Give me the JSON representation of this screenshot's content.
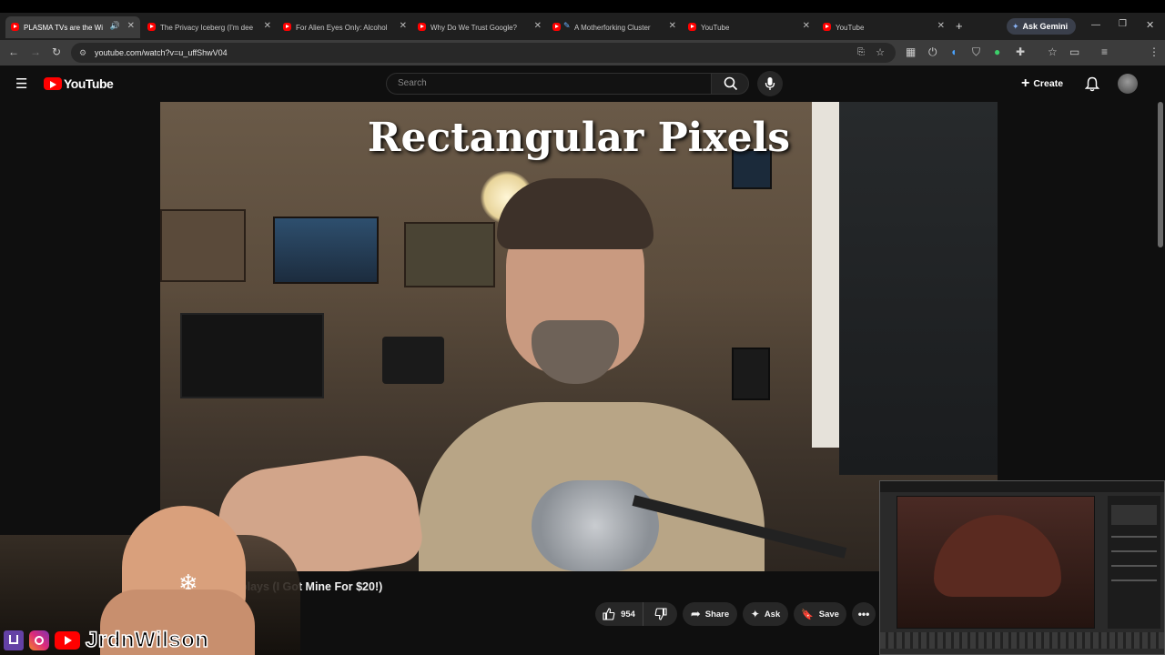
{
  "browser": {
    "tabs": [
      {
        "label": "PLASMA TVs are the Wi",
        "active": true,
        "audio": true
      },
      {
        "label": "The Privacy Iceberg (I'm dee"
      },
      {
        "label": "For Alien Eyes Only: Alcohol"
      },
      {
        "label": "Why Do We Trust Google?"
      },
      {
        "label": "A Motherforking Cluster"
      },
      {
        "label": "YouTube"
      },
      {
        "label": "YouTube"
      }
    ],
    "new_tab": "+",
    "gemini": "Ask Gemini",
    "url": "youtube.com/watch?v=u_uffShwV04"
  },
  "youtube": {
    "logo": "YouTube",
    "search_placeholder": "Search",
    "create_label": "Create"
  },
  "video": {
    "overlay_title": "Rectangular Pixels",
    "title_visible": "plays (I Got Mine For $20!)"
  },
  "actions": {
    "like_count": "954",
    "share": "Share",
    "ask": "Ask",
    "save": "Save"
  },
  "overlay": {
    "brand": "JrdnWilson"
  },
  "colors": {
    "youtube_red": "#ff0000",
    "bg": "#0f0f0f",
    "gemini_bg": "#3a3f4b"
  }
}
